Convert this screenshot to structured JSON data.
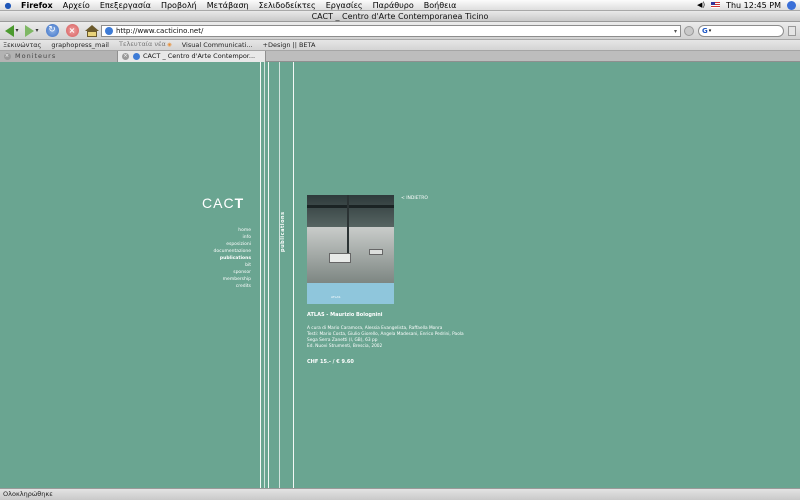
{
  "menubar": {
    "items": [
      "Firefox",
      "Αρχείο",
      "Επεξεργασία",
      "Προβολή",
      "Μετάβαση",
      "Σελιδοδείκτες",
      "Εργασίες",
      "Παράθυρο",
      "Βοήθεια"
    ],
    "clock": "Thu 12:45 PM"
  },
  "window": {
    "title": "CACT _ Centro d'Arte Contemporanea Ticino"
  },
  "toolbar": {
    "url": "http://www.cacticino.net/"
  },
  "bookmarks": {
    "items": [
      "Ξεκινώντας",
      "graphopress_mail",
      "Τελευταία νέα",
      "Visual Communicati...",
      "+Design || BETA"
    ]
  },
  "tabs": [
    {
      "label": "Moniteurs"
    },
    {
      "label": "CACT _ Centro d'Arte Contempor..."
    }
  ],
  "page": {
    "logo_light": "CAC",
    "logo_bold": "T",
    "nav": [
      "home",
      "info",
      "esposizioni",
      "documentazione",
      "publications",
      "bit",
      "sponsor",
      "membership",
      "credits"
    ],
    "current_nav": "publications",
    "section_label": "publications",
    "back_link": "< INDIETRO",
    "cover_caption": "ATLAS",
    "book_title": "ATLAS - Maurizio Bolognini",
    "book_meta": [
      "A cura di Mario Caramora, Alessia Evangelista, Raffaella Monra",
      "Testi: Mario Costa, Giulio Giorello, Angela Madesani, Enrico Pedrini, Paola",
      "Sega Serra Zanetti (I, GB), 63 pp",
      "Ed. Nuovi Strumenti, Brescia, 2002"
    ],
    "price": "CHF 15.- / € 9.60"
  },
  "statusbar": {
    "text": "Ολοκληρώθηκε"
  }
}
